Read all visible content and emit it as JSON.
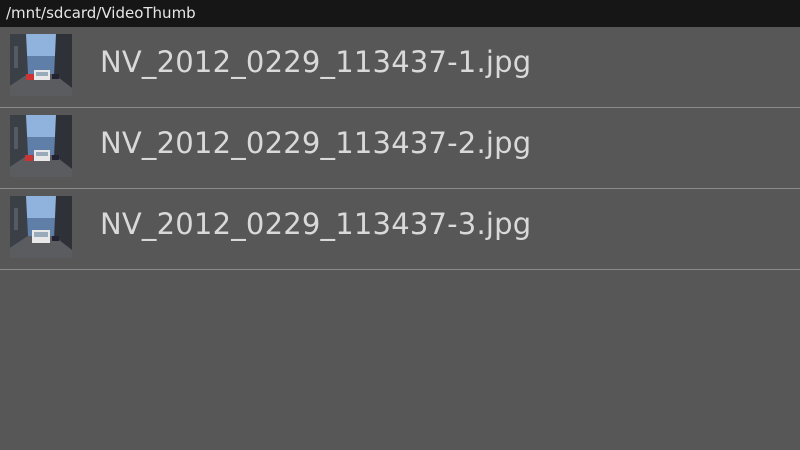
{
  "header": {
    "path": "/mnt/sdcard/VideoThumb"
  },
  "files": [
    {
      "name": "NV_2012_0229_113437-1.jpg",
      "thumbnail_icon": "street-photo-thumbnail"
    },
    {
      "name": "NV_2012_0229_113437-2.jpg",
      "thumbnail_icon": "street-photo-thumbnail"
    },
    {
      "name": "NV_2012_0229_113437-3.jpg",
      "thumbnail_icon": "street-photo-thumbnail"
    }
  ],
  "colors": {
    "background": "#575757",
    "header_background": "#161616",
    "text": "#d9d9d9",
    "divider": "#8a8a8a"
  }
}
